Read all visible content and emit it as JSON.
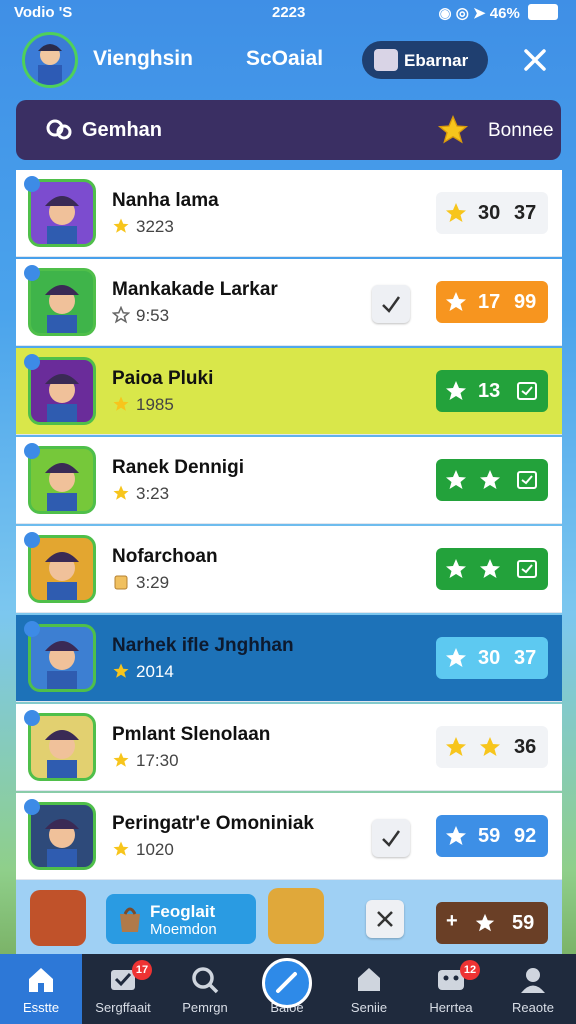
{
  "status_bar": {
    "carrier": "Vodio 'S",
    "time": "2223",
    "battery_pct": "46%"
  },
  "header": {
    "title": "Vienghsin",
    "tab_social": "ScOaial",
    "pill_label": "Ebarnar"
  },
  "banner": {
    "left_label": "Gemhan",
    "right_label": "Bonnee"
  },
  "rows": [
    {
      "name": "Nanha lama",
      "sub": "3223",
      "badge": [
        "30",
        "37"
      ],
      "badge_style": "white",
      "avatar_color": "#7c4ccf",
      "highlight": "none",
      "check": false
    },
    {
      "name": "Mankakade Larkar",
      "sub": "9:53",
      "badge": [
        "17",
        "99"
      ],
      "badge_style": "orange",
      "avatar_color": "#3fb44a",
      "highlight": "none",
      "check": true
    },
    {
      "name": "Paioa Pluki",
      "sub": "1985",
      "badge": [
        "13",
        ""
      ],
      "badge_style": "green",
      "avatar_color": "#6a2c9a",
      "highlight": "yellow",
      "check": false
    },
    {
      "name": "Ranek Dennigi",
      "sub": "3:23",
      "badge": [
        "",
        ""
      ],
      "badge_style": "green",
      "avatar_color": "#76c83a",
      "highlight": "none",
      "check": false
    },
    {
      "name": "Nofarchoan",
      "sub": "3:29",
      "badge": [
        "",
        ""
      ],
      "badge_style": "green",
      "avatar_color": "#e3a630",
      "highlight": "none",
      "check": false
    },
    {
      "name": "Narhek ifle Jnghhan",
      "sub": "2014",
      "badge": [
        "30",
        "37"
      ],
      "badge_style": "sky",
      "avatar_color": "#3d7fd2",
      "highlight": "blue",
      "check": false
    },
    {
      "name": "Pmlant Slenolaan",
      "sub": "17:30",
      "badge": [
        "",
        "36"
      ],
      "badge_style": "white",
      "avatar_color": "#e2d070",
      "highlight": "none",
      "check": false
    },
    {
      "name": "Peringatr'e Omoniniak",
      "sub": "1020",
      "badge": [
        "59",
        "92"
      ],
      "badge_style": "blue",
      "avatar_color": "#2e4a7a",
      "highlight": "none",
      "check": true
    }
  ],
  "bottom_card": {
    "line1": "Feoglait",
    "line2": "Moemdon",
    "badge": "59"
  },
  "nav": [
    {
      "label": "Esstte",
      "active": true,
      "dot": ""
    },
    {
      "label": "Sergffaait",
      "active": false,
      "dot": "17"
    },
    {
      "label": "Pemrgn",
      "active": false,
      "dot": ""
    },
    {
      "label": "Baioe",
      "active": false,
      "dot": ""
    },
    {
      "label": "Seniie",
      "active": false,
      "dot": ""
    },
    {
      "label": "Herrtea",
      "active": false,
      "dot": "12"
    },
    {
      "label": "Reaote",
      "active": false,
      "dot": ""
    }
  ],
  "colors": {
    "accent_blue": "#2e8ae8",
    "row_yellow": "#d9e74a",
    "row_blue": "#1d72b8",
    "nav_bg": "#1f2a3d",
    "banner_bg": "#3a2f63"
  }
}
